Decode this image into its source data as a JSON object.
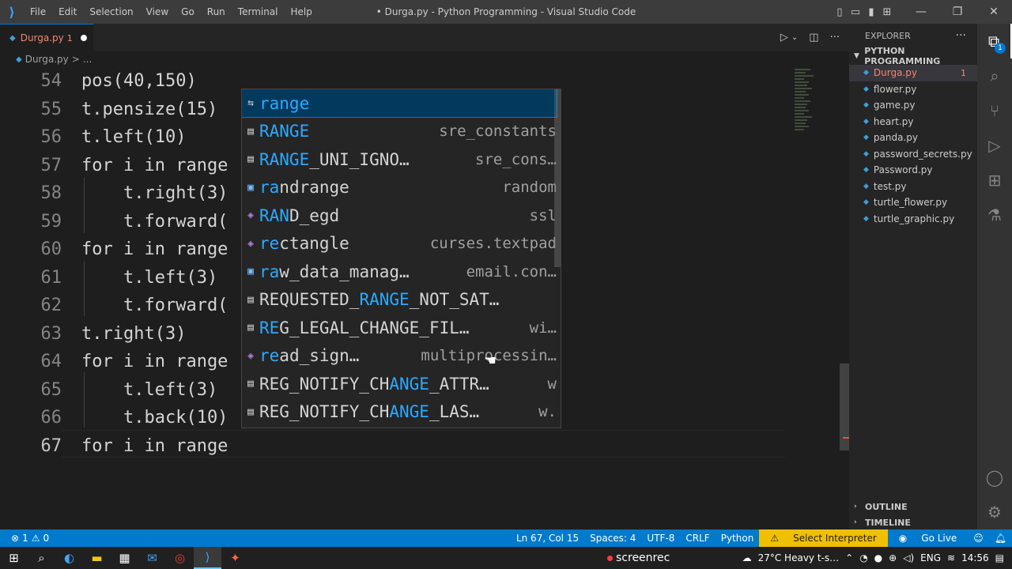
{
  "titlebar": {
    "menu": [
      "File",
      "Edit",
      "Selection",
      "View",
      "Go",
      "Run",
      "Terminal",
      "Help"
    ],
    "title": "• Durga.py - Python Programming - Visual Studio Code"
  },
  "tab": {
    "name": "Durga.py",
    "problems": "1"
  },
  "breadcrumb": {
    "file": "Durga.py",
    "sep": ">",
    "more": "..."
  },
  "editor": {
    "lines": [
      {
        "n": "54",
        "code": "pos(40,150)"
      },
      {
        "n": "55",
        "code": "t.pensize(15)"
      },
      {
        "n": "56",
        "code": "t.left(10)"
      },
      {
        "n": "57",
        "code": "for i in range"
      },
      {
        "n": "58",
        "code": "    t.right(3)"
      },
      {
        "n": "59",
        "code": "    t.forward("
      },
      {
        "n": "60",
        "code": "for i in range"
      },
      {
        "n": "61",
        "code": "    t.left(3)"
      },
      {
        "n": "62",
        "code": "    t.forward("
      },
      {
        "n": "63",
        "code": "t.right(3)"
      },
      {
        "n": "64",
        "code": "for i in range"
      },
      {
        "n": "65",
        "code": "    t.left(3)"
      },
      {
        "n": "66",
        "code": "    t.back(10)"
      },
      {
        "n": "67",
        "code": "for i in range"
      }
    ]
  },
  "suggest": {
    "items": [
      {
        "pre": "",
        "hl": "range",
        "post": "",
        "detail": "",
        "icon": "⇆",
        "kind": "keyword"
      },
      {
        "pre": "",
        "hl": "RANGE",
        "post": "",
        "detail": "sre_constants",
        "icon": "▤",
        "kind": "constant"
      },
      {
        "pre": "",
        "hl": "RANGE",
        "post": "_UNI_IGNO…",
        "detail": "sre_cons…",
        "icon": "▤",
        "kind": "constant"
      },
      {
        "pre": "",
        "hl": "ra",
        "post": "ndrange",
        "detail": "random",
        "icon": "▣",
        "kind": "variable"
      },
      {
        "pre": "",
        "hl": "RAN",
        "post": "D_egd",
        "detail": "ssl",
        "icon": "◈",
        "kind": "method"
      },
      {
        "pre": "",
        "hl": "re",
        "post": "ctangle",
        "detail": "curses.textpad",
        "icon": "◈",
        "kind": "method"
      },
      {
        "pre": "",
        "hl": "ra",
        "post": "w_data_manag…",
        "detail": "email.con…",
        "icon": "▣",
        "kind": "variable"
      },
      {
        "pre": "REQUESTED_",
        "hl": "RANGE",
        "post": "_NOT_SAT…",
        "detail": "",
        "icon": "▤",
        "kind": "constant"
      },
      {
        "pre": "",
        "hl": "RE",
        "post": "G_LEGAL_CHANGE_FIL…",
        "detail": "wi…",
        "icon": "▤",
        "kind": "constant"
      },
      {
        "pre": "",
        "hl": "re",
        "post": "ad_sign…",
        "detail": "multiprocessin…",
        "icon": "◈",
        "kind": "method"
      },
      {
        "pre": "REG_NOTIFY_CH",
        "hl": "ANGE",
        "post": "_ATTR…",
        "detail": "w",
        "icon": "▤",
        "kind": "constant"
      },
      {
        "pre": "REG_NOTIFY_CH",
        "hl": "ANGE",
        "post": "_LAS…",
        "detail": "w.",
        "icon": "▤",
        "kind": "constant"
      }
    ]
  },
  "explorer": {
    "title": "EXPLORER",
    "folder": "PYTHON PROGRAMMING",
    "files": [
      "Durga.py",
      "flower.py",
      "game.py",
      "heart.py",
      "panda.py",
      "password_secrets.py",
      "Password.py",
      "test.py",
      "turtle_flower.py",
      "turtle_graphic.py"
    ],
    "active_error": "1",
    "outline": "OUTLINE",
    "timeline": "TIMELINE"
  },
  "statusbar": {
    "errors": "1",
    "warnings": "0",
    "position": "Ln 67, Col 15",
    "spaces": "Spaces: 4",
    "encoding": "UTF-8",
    "eol": "CRLF",
    "language": "Python",
    "interpreter": "Select Interpreter",
    "golive": "Go Live"
  },
  "taskbar": {
    "screenrec": "screenrec",
    "weather": "27°C  Heavy t-s…",
    "lang": "ENG",
    "time": "14:56"
  },
  "colors": {
    "accent": "#007acc",
    "error": "#f48771",
    "warning_bg": "#f0c000"
  }
}
